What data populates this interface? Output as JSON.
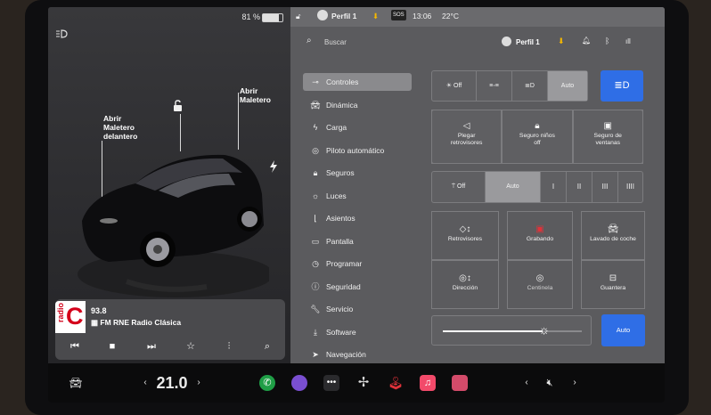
{
  "status_left": {
    "battery": "81 %"
  },
  "topbar": {
    "profile": "Perfil 1",
    "sos": "SOS",
    "time": "13:06",
    "temp": "22°C"
  },
  "search": {
    "placeholder": "Buscar"
  },
  "subbar": {
    "profile": "Perfil 1"
  },
  "callouts": {
    "front_trunk": "Abrir\nMaletero\ndelantero",
    "trunk": "Abrir\nMaletero"
  },
  "media": {
    "logo_word": "radio",
    "logo_letter": "C",
    "frequency": "93.8",
    "station": "FM RNE Radio Clásica"
  },
  "menu": [
    {
      "label": "Controles",
      "icon": "toggle-icon"
    },
    {
      "label": "Dinámica",
      "icon": "car-icon"
    },
    {
      "label": "Carga",
      "icon": "bolt-icon"
    },
    {
      "label": "Piloto automático",
      "icon": "steering-wheel-icon"
    },
    {
      "label": "Seguros",
      "icon": "lock-icon"
    },
    {
      "label": "Luces",
      "icon": "sun-icon"
    },
    {
      "label": "Asientos",
      "icon": "seat-icon"
    },
    {
      "label": "Pantalla",
      "icon": "display-icon"
    },
    {
      "label": "Programar",
      "icon": "clock-icon"
    },
    {
      "label": "Seguridad",
      "icon": "info-icon"
    },
    {
      "label": "Servicio",
      "icon": "wrench-icon"
    },
    {
      "label": "Software",
      "icon": "download-icon"
    },
    {
      "label": "Navegación",
      "icon": "navigation-icon"
    }
  ],
  "lights_row": {
    "off": "Off",
    "auto": "Auto"
  },
  "tiles1": [
    {
      "label": "Plegar\nretrovisores"
    },
    {
      "label": "Seguro niños\noff"
    },
    {
      "label": "Seguro de\nventanas"
    }
  ],
  "wipers": {
    "off": "Off",
    "auto": "Auto",
    "speeds": [
      "I",
      "II",
      "III",
      "IIII"
    ]
  },
  "tiles2": [
    {
      "label": "Retrovisores"
    },
    {
      "label": "Grabando"
    },
    {
      "label": "Lavado de coche"
    },
    {
      "label": "Dirección"
    },
    {
      "label": "Centinela"
    },
    {
      "label": "Guantera"
    }
  ],
  "brightness": {
    "auto": "Auto",
    "level": 0.72
  },
  "dock": {
    "temperature": "21.0"
  },
  "colors": {
    "accent": "#2f6ee6",
    "panel": "#5b5b5e",
    "record": "#e0323a"
  }
}
